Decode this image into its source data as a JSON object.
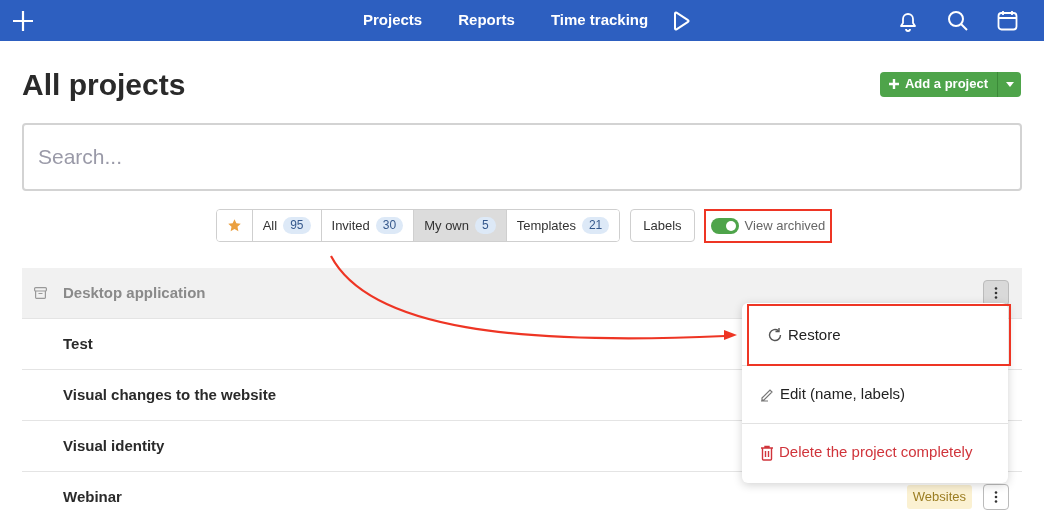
{
  "nav": {
    "links": [
      "Projects",
      "Reports",
      "Time tracking"
    ]
  },
  "title": "All projects",
  "add_button": {
    "label": "Add a project"
  },
  "search": {
    "placeholder": "Search..."
  },
  "filters": [
    {
      "kind": "star",
      "selected": false
    },
    {
      "label": "All",
      "count": "95",
      "selected": false
    },
    {
      "label": "Invited",
      "count": "30",
      "selected": false
    },
    {
      "label": "My own",
      "count": "5",
      "selected": true
    },
    {
      "label": "Templates",
      "count": "21",
      "selected": false
    }
  ],
  "labels_button": "Labels",
  "view_archived": {
    "label": "View archived",
    "on": true,
    "highlighted": true
  },
  "projects": [
    {
      "name": "Desktop application",
      "archived": true,
      "menu_open": true
    },
    {
      "name": "Test",
      "archived": false
    },
    {
      "name": "Visual changes to the website",
      "archived": false
    },
    {
      "name": "Visual identity",
      "archived": false
    },
    {
      "name": "Webinar",
      "archived": false,
      "menu_open": false,
      "label": "Websites"
    }
  ],
  "menu": [
    {
      "kind": "restore",
      "label": "Restore",
      "highlighted": true
    },
    {
      "kind": "edit",
      "label": "Edit (name, labels)",
      "highlighted": false
    },
    {
      "kind": "delete",
      "label": "Delete the project completely",
      "highlighted": false
    }
  ]
}
